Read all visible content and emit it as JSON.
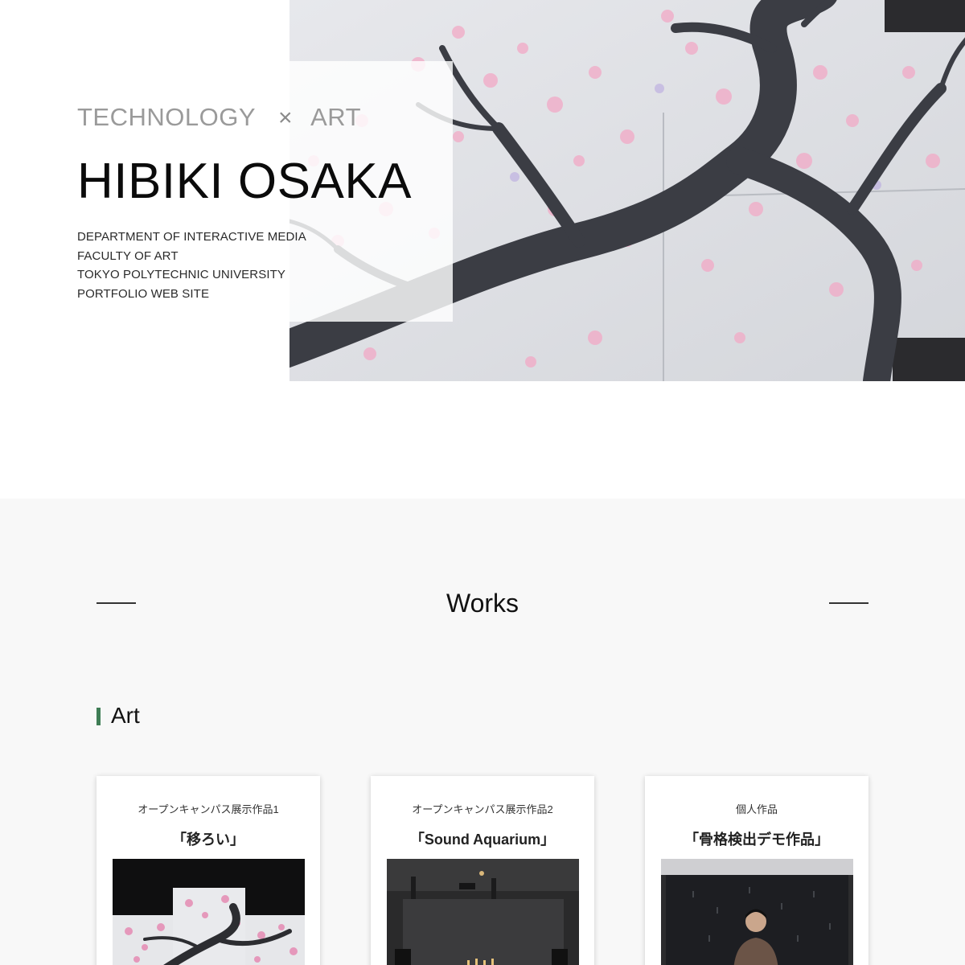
{
  "hero": {
    "tagline_left": "TECHNOLOGY",
    "tagline_cross": "×",
    "tagline_right": "ART",
    "name": "HIBIKI OSAKA",
    "lines": [
      "DEPARTMENT OF INTERACTIVE MEDIA",
      "FACULTY OF ART",
      "TOKYO POLYTECHNIC UNIVERSITY",
      "PORTFOLIO WEB SITE"
    ],
    "image_icon": "cherry-tree-artwork"
  },
  "works": {
    "title": "Works",
    "category": "Art",
    "accent_color": "#3f7d55",
    "cards": [
      {
        "subtitle": "オープンキャンパス展示作品1",
        "title": "「移ろい」",
        "thumb_icon": "cherry-blossom-installation"
      },
      {
        "subtitle": "オープンキャンパス展示作品2",
        "title": "「Sound Aquarium」",
        "thumb_icon": "dark-room-installation"
      },
      {
        "subtitle": "個人作品",
        "title": "「骨格検出デモ作品」",
        "thumb_icon": "person-demo-photo"
      }
    ]
  }
}
